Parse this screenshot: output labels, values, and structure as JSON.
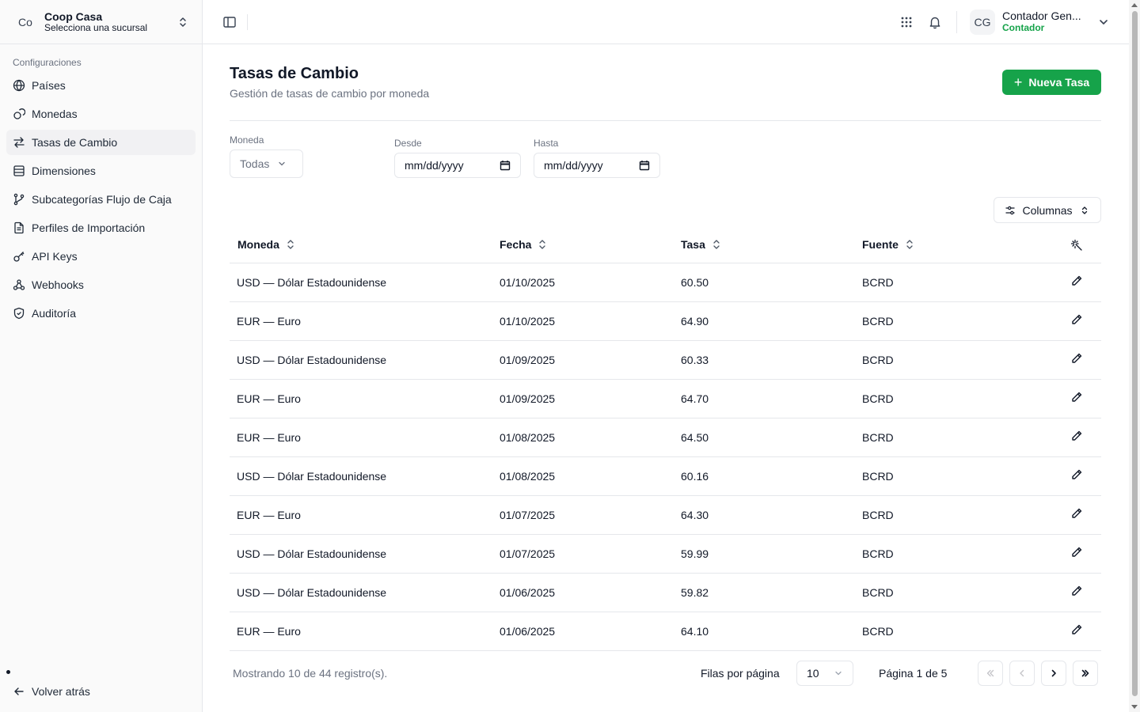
{
  "org": {
    "avatar": "Co",
    "name": "Coop Casa",
    "subtitle": "Selecciona una sucursal"
  },
  "sidebar": {
    "group_label": "Configuraciones",
    "items": [
      {
        "label": "Países",
        "icon": "globe-icon"
      },
      {
        "label": "Monedas",
        "icon": "coins-icon"
      },
      {
        "label": "Tasas de Cambio",
        "icon": "arrows-exchange-icon",
        "active": true
      },
      {
        "label": "Dimensiones",
        "icon": "table-rows-icon"
      },
      {
        "label": "Subcategorías Flujo de Caja",
        "icon": "git-branch-icon"
      },
      {
        "label": "Perfiles de Importación",
        "icon": "file-text-icon"
      },
      {
        "label": "API Keys",
        "icon": "key-icon"
      },
      {
        "label": "Webhooks",
        "icon": "webhook-icon"
      },
      {
        "label": "Auditoría",
        "icon": "shield-check-icon"
      }
    ],
    "back_label": "Volver atrás"
  },
  "header": {
    "user_avatar": "CG",
    "user_name": "Contador Gen...",
    "user_role": "Contador"
  },
  "page": {
    "title": "Tasas de Cambio",
    "subtitle": "Gestión de tasas de cambio por moneda",
    "new_button": "Nueva Tasa"
  },
  "filters": {
    "currency_label": "Moneda",
    "currency_value": "Todas",
    "from_label": "Desde",
    "from_value": "mm/dd/yyyy",
    "to_label": "Hasta",
    "to_value": "mm/dd/yyyy"
  },
  "columns_button": "Columnas",
  "table": {
    "headers": [
      "Moneda",
      "Fecha",
      "Tasa",
      "Fuente"
    ],
    "rows": [
      [
        "USD — Dólar Estadounidense",
        "01/10/2025",
        "60.50",
        "BCRD"
      ],
      [
        "EUR — Euro",
        "01/10/2025",
        "64.90",
        "BCRD"
      ],
      [
        "USD — Dólar Estadounidense",
        "01/09/2025",
        "60.33",
        "BCRD"
      ],
      [
        "EUR — Euro",
        "01/09/2025",
        "64.70",
        "BCRD"
      ],
      [
        "EUR — Euro",
        "01/08/2025",
        "64.50",
        "BCRD"
      ],
      [
        "USD — Dólar Estadounidense",
        "01/08/2025",
        "60.16",
        "BCRD"
      ],
      [
        "EUR — Euro",
        "01/07/2025",
        "64.30",
        "BCRD"
      ],
      [
        "USD — Dólar Estadounidense",
        "01/07/2025",
        "59.99",
        "BCRD"
      ],
      [
        "USD — Dólar Estadounidense",
        "01/06/2025",
        "59.82",
        "BCRD"
      ],
      [
        "EUR — Euro",
        "01/06/2025",
        "64.10",
        "BCRD"
      ]
    ]
  },
  "footer": {
    "showing": "Mostrando 10 de 44 registro(s).",
    "rows_per_page_label": "Filas por página",
    "rows_per_page_value": "10",
    "page_info": "Página 1 de 5"
  },
  "colors": {
    "accent": "#16a34a",
    "border": "#e5e7eb",
    "muted": "#6b7280"
  }
}
